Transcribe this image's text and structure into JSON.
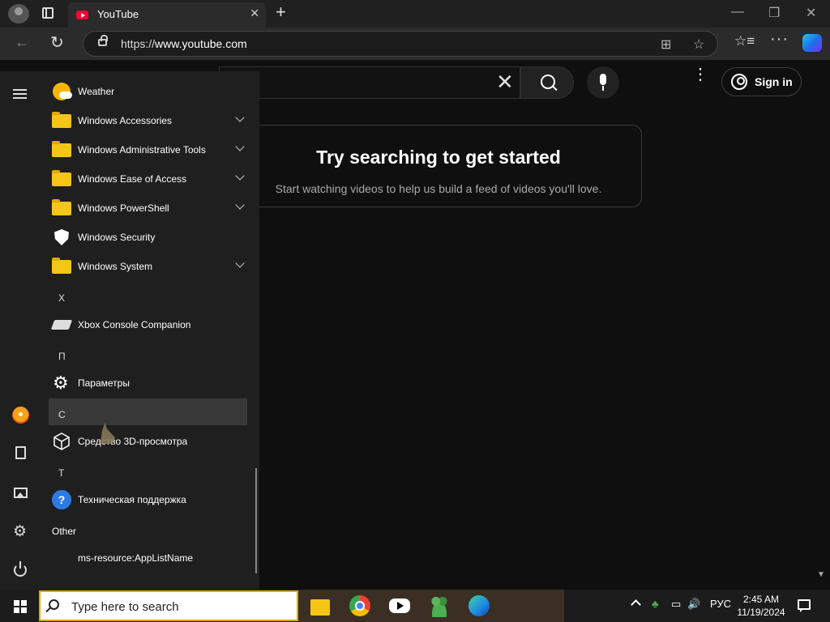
{
  "browser": {
    "tab_title": "YouTube",
    "tab_close": "✕",
    "new_tab": "+",
    "url_prefix": "https://",
    "url_host": "www.youtube.com",
    "minimize": "—",
    "restore": "❐",
    "close": "✕",
    "back": "←",
    "reload": "↻",
    "more": "···",
    "favorites": "☆≡"
  },
  "youtube": {
    "search_clear": "✕",
    "more_menu": "⋮",
    "signin_label": "Sign in",
    "empty_title": "Try searching to get started",
    "empty_subtitle": "Start watching videos to help us build a feed of videos you'll love."
  },
  "start_menu": {
    "apps": [
      {
        "label": "Weather",
        "icon": "weather-icon"
      },
      {
        "label": "Windows Accessories",
        "icon": "folder-icon",
        "expandable": true
      },
      {
        "label": "Windows Administrative Tools",
        "icon": "folder-icon",
        "expandable": true
      },
      {
        "label": "Windows Ease of Access",
        "icon": "folder-icon",
        "expandable": true
      },
      {
        "label": "Windows PowerShell",
        "icon": "folder-icon",
        "expandable": true
      },
      {
        "label": "Windows Security",
        "icon": "shield-icon"
      },
      {
        "label": "Windows System",
        "icon": "folder-icon",
        "expandable": true
      }
    ],
    "letter_x": "X",
    "xbox": "Xbox Console Companion",
    "letter_p": "П",
    "params": "Параметры",
    "letter_c": "С",
    "viewer3d": "Средство 3D-просмотра",
    "letter_t": "Т",
    "support": "Техническая поддержка",
    "other_header": "Other",
    "applistname": "ms-resource:AppListName",
    "help_glyph": "?",
    "gear_glyph": "⚙"
  },
  "taskbar": {
    "search_placeholder": "Type here to search",
    "language": "РУС",
    "time": "2:45 AM",
    "date": "11/19/2024",
    "tray_speaker": "🔊"
  },
  "colors": {
    "accent_search_border": "#e0a800",
    "youtube_red": "#ff0033",
    "page_bg": "#0f0f0f",
    "start_bg": "#1f1f1f"
  }
}
